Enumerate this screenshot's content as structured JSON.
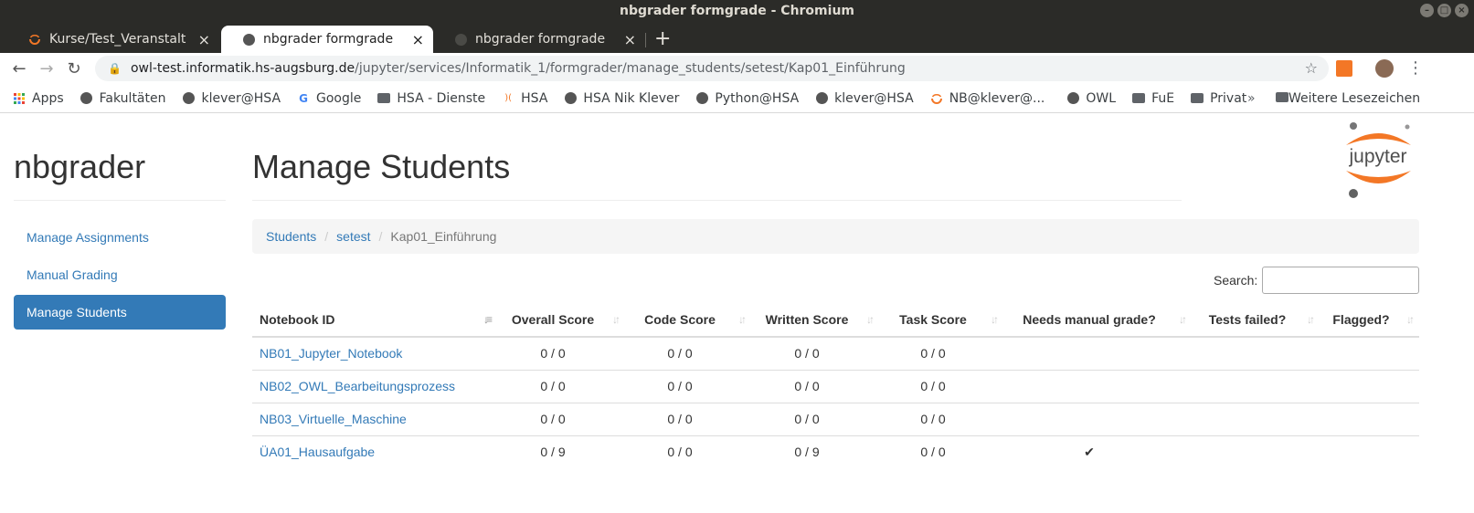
{
  "window": {
    "title": "nbgrader formgrade - Chromium"
  },
  "tabs": [
    {
      "label": "Kurse/Test_Veranstaltung"
    },
    {
      "label": "nbgrader formgrade"
    },
    {
      "label": "nbgrader formgrade"
    }
  ],
  "omnibox": {
    "host": "owl-test.informatik.hs-augsburg.de",
    "path": "/jupyter/services/Informatik_1/formgrader/manage_students/setest/Kap01_Einführung"
  },
  "bookmarks": [
    {
      "label": "Apps",
      "icon": "apps-grid-icon"
    },
    {
      "label": "Fakultäten",
      "icon": "globe-icon"
    },
    {
      "label": "klever@HSA",
      "icon": "globe-icon"
    },
    {
      "label": "Google",
      "icon": "google-icon"
    },
    {
      "label": "HSA - Dienste",
      "icon": "folder-icon"
    },
    {
      "label": "HSA",
      "icon": "hsa-icon"
    },
    {
      "label": "HSA Nik Klever",
      "icon": "globe-icon"
    },
    {
      "label": "Python@HSA",
      "icon": "globe-icon"
    },
    {
      "label": "klever@HSA",
      "icon": "globe-icon"
    },
    {
      "label": "NB@klever@...",
      "icon": "jupyter-icon"
    },
    {
      "label": "OWL",
      "icon": "globe-icon"
    },
    {
      "label": "FuE",
      "icon": "folder-icon"
    },
    {
      "label": "Privat",
      "icon": "folder-icon"
    }
  ],
  "bookmarks_more": "»",
  "bookmarks_other": "Weitere Lesezeichen",
  "app": {
    "brand": "nbgrader",
    "nav": [
      {
        "label": "Manage Assignments"
      },
      {
        "label": "Manual Grading"
      },
      {
        "label": "Manage Students"
      }
    ],
    "page_title": "Manage Students",
    "logo_text": "jupyter",
    "breadcrumb": [
      "Students",
      "setest",
      "Kap01_Einführung"
    ],
    "search_label": "Search:",
    "search_value": "",
    "columns": [
      "Notebook ID",
      "Overall Score",
      "Code Score",
      "Written Score",
      "Task Score",
      "Needs manual grade?",
      "Tests failed?",
      "Flagged?"
    ],
    "rows": [
      {
        "id": "NB01_Jupyter_Notebook",
        "overall": "0 / 0",
        "code": "0 / 0",
        "written": "0 / 0",
        "task": "0 / 0",
        "manual": "",
        "failed": "",
        "flagged": ""
      },
      {
        "id": "NB02_OWL_Bearbeitungsprozess",
        "overall": "0 / 0",
        "code": "0 / 0",
        "written": "0 / 0",
        "task": "0 / 0",
        "manual": "",
        "failed": "",
        "flagged": ""
      },
      {
        "id": "NB03_Virtuelle_Maschine",
        "overall": "0 / 0",
        "code": "0 / 0",
        "written": "0 / 0",
        "task": "0 / 0",
        "manual": "",
        "failed": "",
        "flagged": ""
      },
      {
        "id": "ÜA01_Hausaufgabe",
        "overall": "0 / 9",
        "code": "0 / 0",
        "written": "0 / 9",
        "task": "0 / 0",
        "manual": "✔",
        "failed": "",
        "flagged": ""
      }
    ]
  },
  "colors": {
    "link": "#337ab7",
    "active_nav": "#337ab7",
    "jupyter_orange": "#f37726"
  }
}
